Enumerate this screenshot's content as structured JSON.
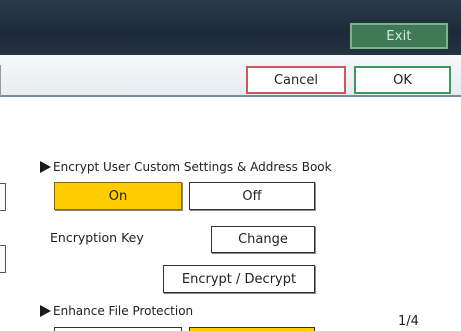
{
  "topbar": {
    "exit_label": "Exit"
  },
  "actionbar": {
    "cancel_label": "Cancel",
    "ok_label": "OK"
  },
  "section1": {
    "title": "Encrypt User Custom Settings & Address Book",
    "on_label": "On",
    "off_label": "Off",
    "selected": "On",
    "encryption_key_label": "Encryption Key",
    "change_label": "Change",
    "encrypt_decrypt_label": "Encrypt / Decrypt"
  },
  "section2": {
    "title": "Enhance File Protection"
  },
  "pager": {
    "page": "1/4"
  },
  "colors": {
    "selected": "#ffcc00",
    "exit": "#3d7a55",
    "cancel_border": "#c9595b",
    "ok_border": "#3c9a5c"
  }
}
